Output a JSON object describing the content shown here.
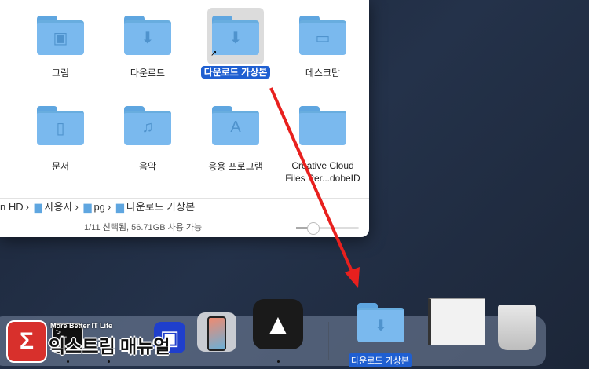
{
  "finder": {
    "items": [
      {
        "label": "그림",
        "icon": "photo-folder-icon"
      },
      {
        "label": "다운로드",
        "icon": "download-folder-icon"
      },
      {
        "label": "다운로드 가상본",
        "icon": "download-folder-alias-icon",
        "selected": true
      },
      {
        "label": "데스크탑",
        "icon": "desktop-folder-icon"
      },
      {
        "label": "문서",
        "icon": "document-folder-icon"
      },
      {
        "label": "음악",
        "icon": "music-folder-icon"
      },
      {
        "label": "응용 프로그램",
        "icon": "applications-folder-icon"
      },
      {
        "label": "Creative Cloud Files Per...dobeID",
        "icon": "folder-icon"
      }
    ],
    "path": [
      "n HD",
      "사용자",
      "pg",
      "다운로드 가상본"
    ],
    "status": "1/11 선택됨, 56.71GB 사용 가능",
    "icon_size_slider": 0.2
  },
  "dock": {
    "dragged_label": "다운로드 가상본"
  },
  "watermark": {
    "tagline": "More Better IT Life",
    "name": "익스트림 매뉴얼"
  },
  "colors": {
    "accent": "#1f5fd1",
    "arrow": "#e8201e",
    "folder": "#7ab9ee"
  }
}
